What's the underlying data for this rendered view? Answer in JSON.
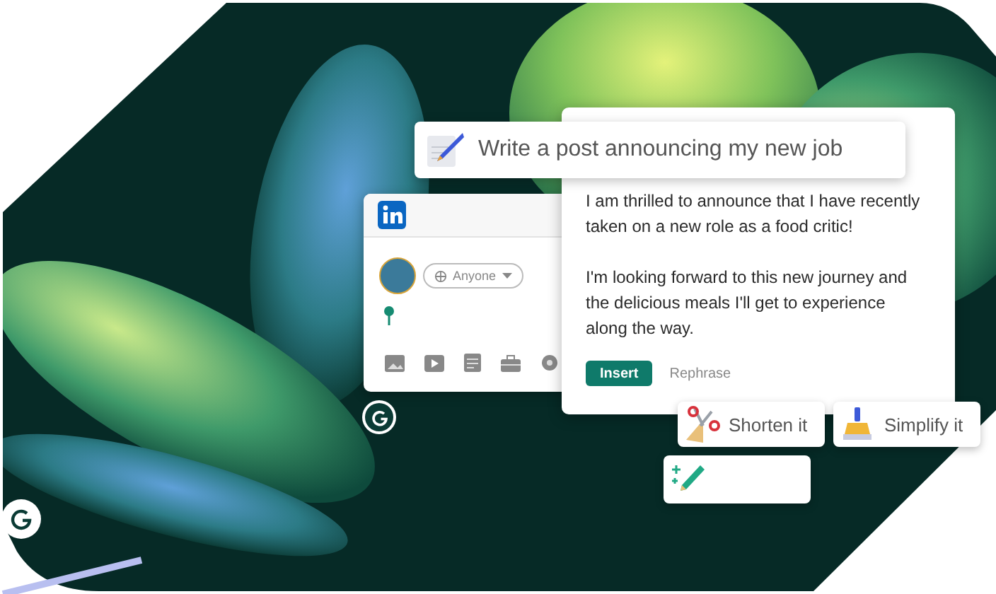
{
  "prompt": {
    "text": "Write a post announcing my new job"
  },
  "post_composer": {
    "visibility": "Anyone"
  },
  "suggestion": {
    "paragraphs": [
      "I am thrilled to announce that I have recently taken on a new role as a food critic!",
      "I'm looking forward to this new journey and the delicious meals I'll get to experience along the way."
    ],
    "actions": [
      {
        "label": "Insert",
        "kind": "primary"
      },
      {
        "label": "Rephrase",
        "kind": "secondary"
      }
    ]
  },
  "quick_actions": [
    {
      "label": "Shorten it",
      "kind": "scissors"
    },
    {
      "label": "Simplify it",
      "kind": "broom"
    },
    {
      "kind": "pencil"
    }
  ]
}
